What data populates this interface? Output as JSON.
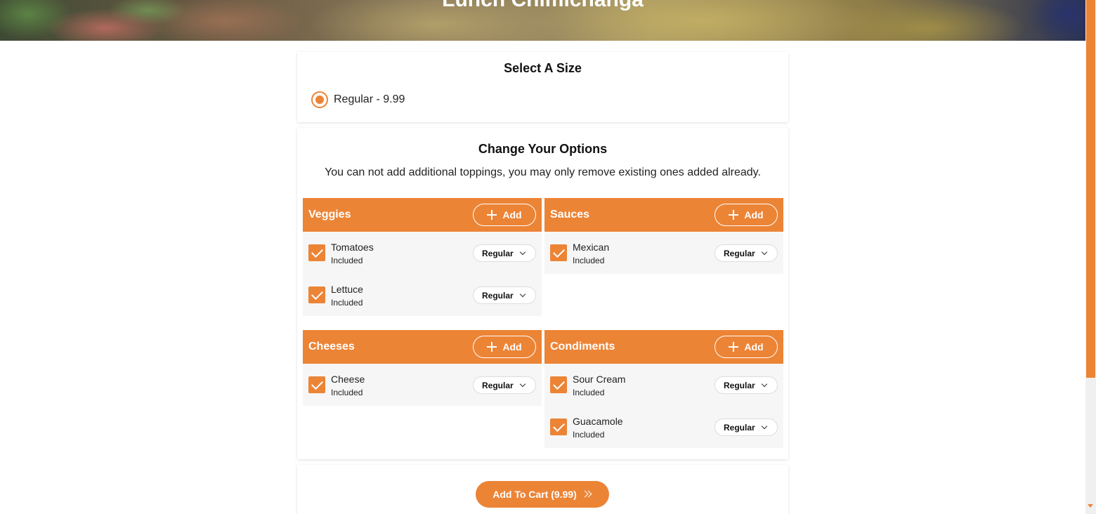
{
  "item": {
    "title": "Lunch Chimichanga"
  },
  "size": {
    "heading": "Select A Size",
    "options": [
      {
        "label": "Regular - 9.99",
        "selected": true
      }
    ]
  },
  "options": {
    "heading": "Change Your Options",
    "note": "You can not add additional toppings, you may only remove existing ones added already.",
    "add_label": "Add",
    "groups": [
      {
        "name": "Veggies",
        "items": [
          {
            "name": "Tomatoes",
            "status": "Included",
            "portion": "Regular",
            "checked": true
          },
          {
            "name": "Lettuce",
            "status": "Included",
            "portion": "Regular",
            "checked": true
          }
        ]
      },
      {
        "name": "Sauces",
        "items": [
          {
            "name": "Mexican",
            "status": "Included",
            "portion": "Regular",
            "checked": true
          }
        ]
      },
      {
        "name": "Cheeses",
        "items": [
          {
            "name": "Cheese",
            "status": "Included",
            "portion": "Regular",
            "checked": true
          }
        ]
      },
      {
        "name": "Condiments",
        "items": [
          {
            "name": "Sour Cream",
            "status": "Included",
            "portion": "Regular",
            "checked": true
          },
          {
            "name": "Guacamole",
            "status": "Included",
            "portion": "Regular",
            "checked": true
          }
        ]
      }
    ]
  },
  "cart": {
    "button_label": "Add To Cart (9.99)"
  },
  "colors": {
    "accent": "#ec8436",
    "item_bg": "#f6f6f6"
  },
  "icons": {
    "add": "plus-icon",
    "portion": "chevron-down-icon",
    "cart": "double-chevron-right-icon"
  }
}
